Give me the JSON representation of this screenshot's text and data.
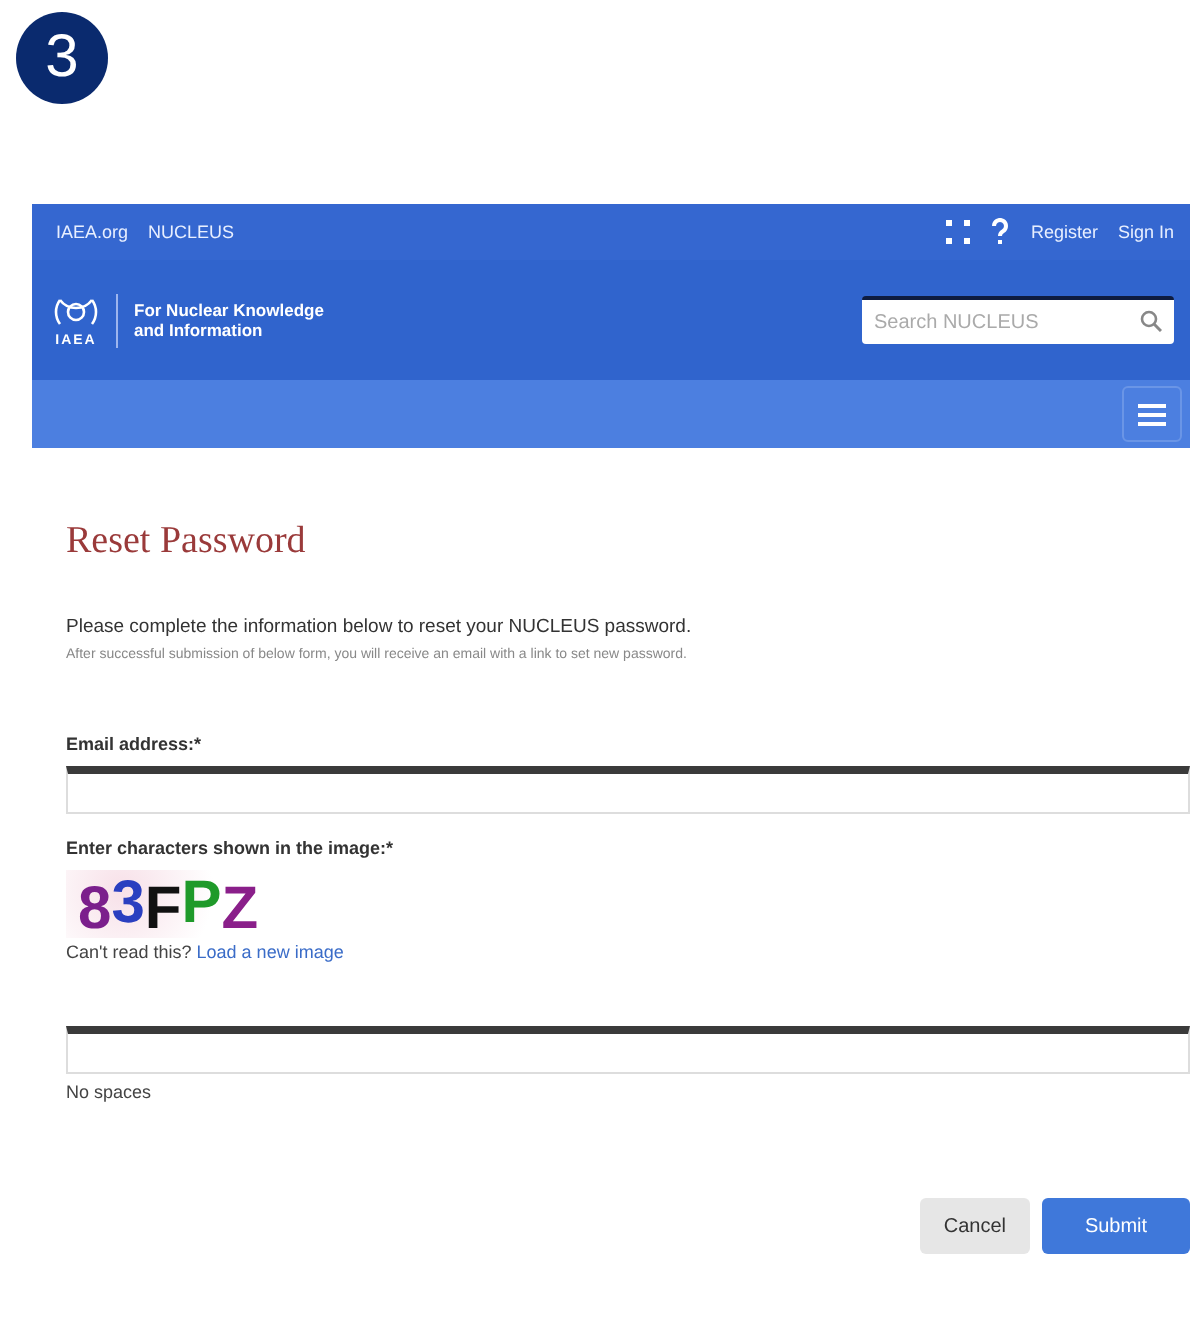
{
  "step_badge": "3",
  "top_bar": {
    "links": [
      "IAEA.org",
      "NUCLEUS"
    ],
    "actions": [
      "Register",
      "Sign In"
    ]
  },
  "header": {
    "logo_text": "IAEA",
    "tagline": [
      "For Nuclear Knowledge",
      "and Information"
    ],
    "search": {
      "placeholder": "Search NUCLEUS"
    }
  },
  "title": "Reset Password",
  "intro": "Please complete the information below to reset your NUCLEUS password.",
  "note": "After successful submission of below form, you will receive an email with a link to set new password.",
  "email": {
    "label": "Email address:*"
  },
  "captcha": {
    "label": "Enter characters shown in the image:*",
    "characters": [
      {
        "char": "8",
        "color": "#7b1f8c"
      },
      {
        "char": "3",
        "color": "#2a3fc0"
      },
      {
        "char": "F",
        "color": "#111111"
      },
      {
        "char": "P",
        "color": "#1f9a2a"
      },
      {
        "char": "Z",
        "color": "#8a1f8a"
      }
    ],
    "prompt": "Can't read this?",
    "link": "Load a new image",
    "hint": "No spaces"
  },
  "buttons": [
    {
      "label": "Cancel",
      "kind": "secondary"
    },
    {
      "label": "Submit",
      "kind": "primary"
    }
  ]
}
